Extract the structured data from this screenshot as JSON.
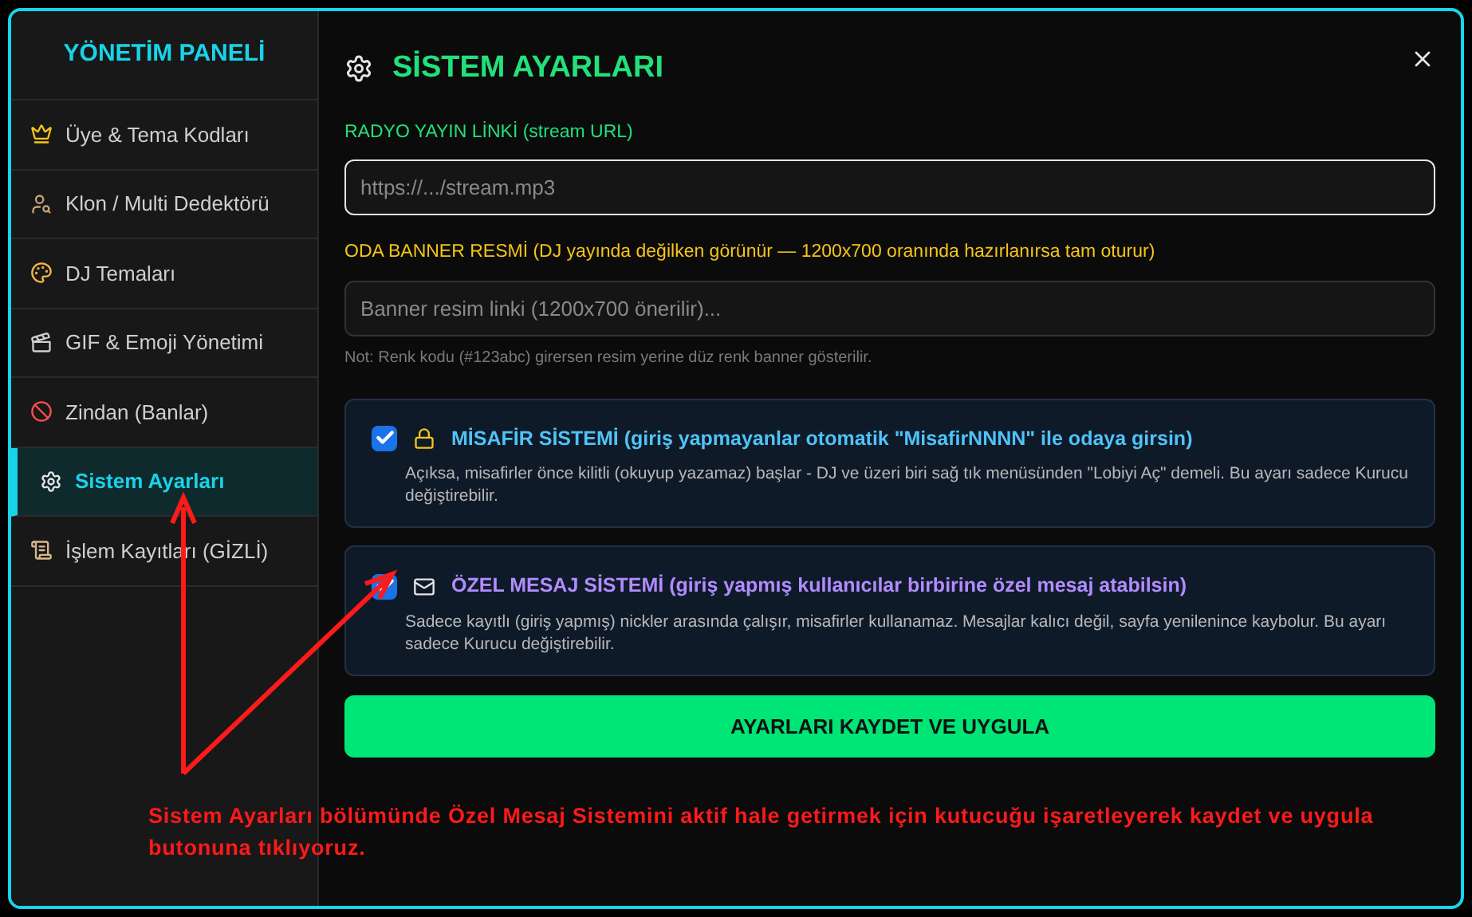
{
  "sidebar": {
    "title": "YÖNETİM PANELİ",
    "items": [
      {
        "label": "Üye & Tema Kodları",
        "selected": false
      },
      {
        "label": "Klon / Multi Dedektörü",
        "selected": false
      },
      {
        "label": "DJ Temaları",
        "selected": false
      },
      {
        "label": "GIF & Emoji Yönetimi",
        "selected": false
      },
      {
        "label": "Zindan (Banlar)",
        "selected": false
      },
      {
        "label": "Sistem Ayarları",
        "selected": true
      },
      {
        "label": "İşlem Kayıtları (GİZLİ)",
        "selected": false
      }
    ]
  },
  "main": {
    "title": "SİSTEM AYARLARI",
    "fields": [
      {
        "label": "RADYO YAYIN LİNKİ (stream URL)",
        "color": "#22e07a",
        "placeholder": "https://.../stream.mp3",
        "focused": true
      },
      {
        "label": "ODA BANNER RESMİ (DJ yayında değilken görünür — 1200x700 oranında hazırlanırsa tam oturur)",
        "color": "#f5c518",
        "placeholder": "Banner resim linki (1200x700 önerilir)...",
        "focused": false
      }
    ],
    "note": "Not: Renk kodu (#123abc) girersen resim yerine düz renk banner gösterilir.",
    "options": [
      {
        "title": "MİSAFİR SİSTEMİ (giriş yapmayanlar otomatik \"MisafirNNNN\" ile odaya girsin)",
        "color": "#4fc3f7",
        "description": "Açıksa, misafirler önce kilitli (okuyup yazamaz) başlar - DJ ve üzeri biri sağ tık menüsünden \"Lobiyi Aç\" demeli. Bu ayarı sadece Kurucu değiştirebilir.",
        "checked": true
      },
      {
        "title": "ÖZEL MESAJ SİSTEMİ (giriş yapmış kullanıcılar birbirine özel mesaj atabilsin)",
        "color": "#b18cff",
        "description": "Sadece kayıtlı (giriş yapmış) nickler arasında çalışır, misafirler kullanamaz. Mesajlar kalıcı değil, sayfa yenilenince kaybolur. Bu ayarı sadece Kurucu değiştirebilir.",
        "checked": true
      }
    ],
    "button": "AYARLARI KAYDET VE UYGULA"
  },
  "annotation": "Sistem Ayarları bölümünde Özel Mesaj Sistemini aktif hale getirmek için kutucuğu işaretleyerek kaydet ve uygula butonuna tıklıyoruz."
}
